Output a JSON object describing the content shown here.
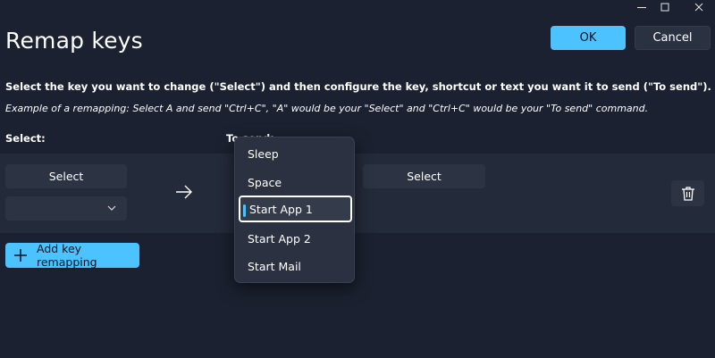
{
  "window": {
    "controls": [
      "minimize-icon",
      "maximize-icon",
      "close-icon"
    ]
  },
  "header": {
    "title": "Remap keys",
    "ok_label": "OK",
    "cancel_label": "Cancel"
  },
  "instructions": {
    "main": "Select the key you want to change (\"Select\") and then configure the key, shortcut or text you want it to send (\"To send\").",
    "example": "Example of a remapping: Select A and send \"Ctrl+C\", \"A\" would be your \"Select\" and \"Ctrl+C\" would be your \"To send\" command."
  },
  "columns": {
    "select_label": "Select:",
    "to_send_label": "To send:"
  },
  "row": {
    "select_button_label": "Select",
    "select_dropdown_value": "",
    "to_send_button_label": "Select",
    "arrow_icon": "arrow-right-icon",
    "delete_icon": "trash-icon"
  },
  "add_button": {
    "label": "Add key remapping",
    "icon": "plus-icon"
  },
  "dropdown_menu": {
    "items": [
      "Sleep",
      "Space",
      "Start App 1",
      "Start App 2",
      "Start Mail"
    ],
    "selected": "Start App 1"
  },
  "colors": {
    "background": "#1b2130",
    "row_band": "#232a39",
    "accent": "#4cc2ff",
    "control": "#2c3443"
  }
}
